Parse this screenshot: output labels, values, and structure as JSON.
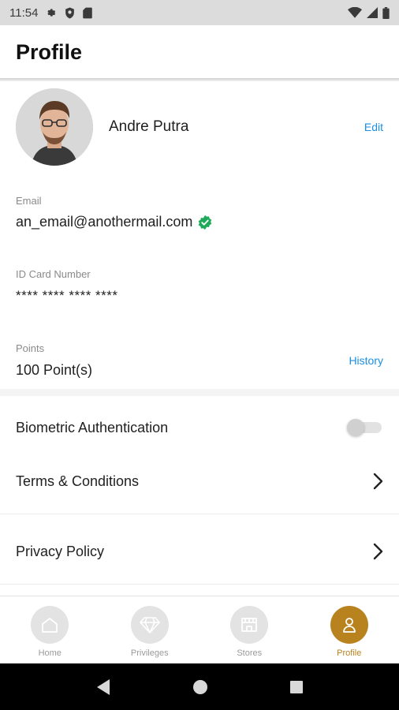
{
  "status_bar": {
    "time": "11:54"
  },
  "header": {
    "title": "Profile"
  },
  "profile": {
    "name": "Andre Putra",
    "edit_label": "Edit",
    "email_label": "Email",
    "email_value": "an_email@anothermail.com",
    "id_label": "ID Card Number",
    "id_value": "**** **** **** ****",
    "points_label": "Points",
    "points_value": "100 Point(s)",
    "history_label": "History"
  },
  "settings": {
    "biometric_label": "Biometric Authentication",
    "biometric_enabled": false,
    "terms_label": "Terms & Conditions",
    "privacy_label": "Privacy Policy"
  },
  "bottom_nav": {
    "items": [
      {
        "label": "Home",
        "icon": "home-icon",
        "active": false
      },
      {
        "label": "Privileges",
        "icon": "diamond-icon",
        "active": false
      },
      {
        "label": "Stores",
        "icon": "store-icon",
        "active": false
      },
      {
        "label": "Profile",
        "icon": "person-icon",
        "active": true
      }
    ]
  },
  "colors": {
    "accent": "#b8821f",
    "link": "#1a8fe3",
    "verified": "#1faa59"
  }
}
